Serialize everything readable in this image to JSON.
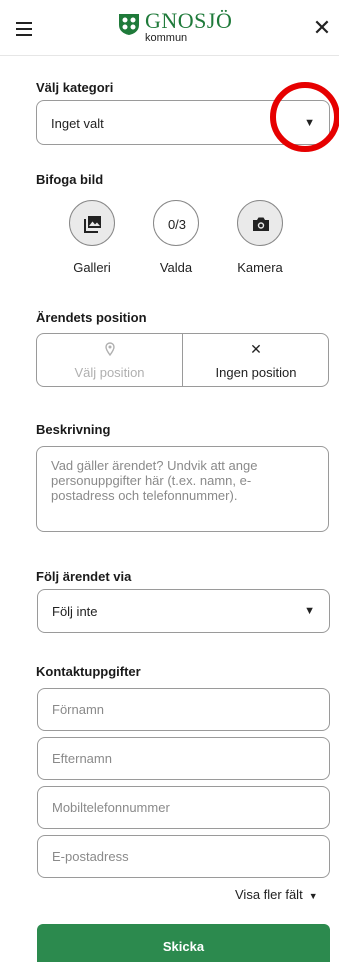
{
  "header": {
    "brand_name": "GNOSJÖ",
    "brand_sub": "kommun",
    "menu_icon": "hamburger-icon",
    "close_icon": "close-icon",
    "brand_color": "#1f7a3a"
  },
  "category": {
    "label": "Välj kategori",
    "value": "Inget valt",
    "caret": "▼"
  },
  "image": {
    "label": "Bifoga bild",
    "gallery": "Galleri",
    "selected": "Valda",
    "selected_count": "0/3",
    "camera": "Kamera"
  },
  "position": {
    "label": "Ärendets position",
    "choose": "Välj position",
    "none": "Ingen position",
    "none_glyph": "✕"
  },
  "description": {
    "label": "Beskrivning",
    "placeholder": "Vad gäller ärendet? Undvik att ange personuppgifter här (t.ex. namn, e-postadress och telefonnummer)."
  },
  "follow": {
    "label": "Följ ärendet via",
    "value": "Följ inte",
    "caret": "▼"
  },
  "contact": {
    "label": "Kontaktuppgifter",
    "first_name": "Förnamn",
    "last_name": "Efternamn",
    "mobile": "Mobiltelefonnummer",
    "email": "E-postadress",
    "more_fields": "Visa fler fält",
    "more_caret": "▼"
  },
  "submit": {
    "label": "Skicka",
    "color": "#2c8a4e"
  },
  "annotation_color": "#e60000"
}
